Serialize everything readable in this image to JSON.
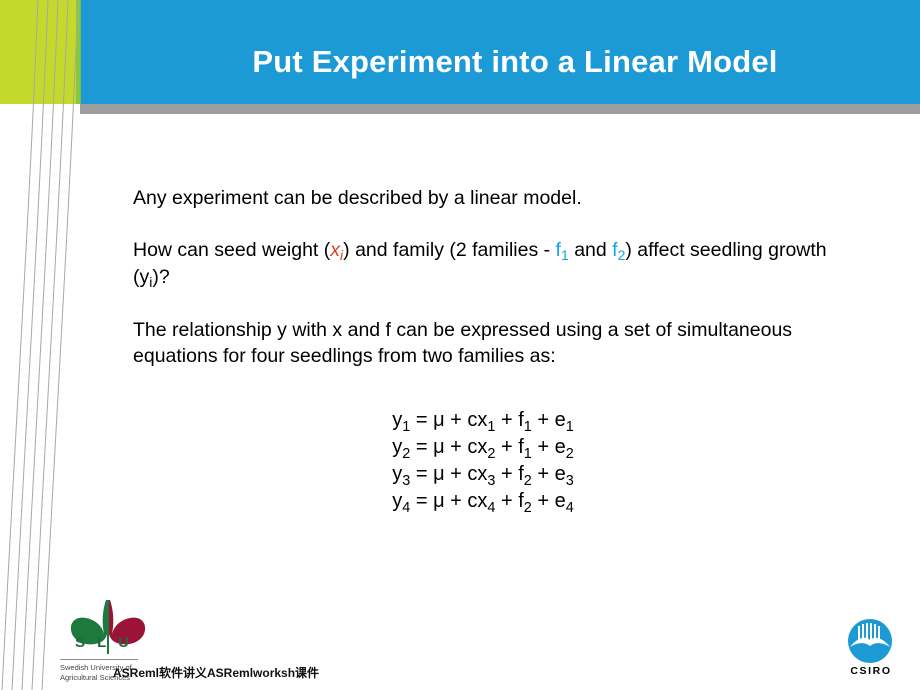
{
  "slide": {
    "title": "Put Experiment into a Linear Model",
    "theme": {
      "header_blue": "#1b9ad6",
      "header_green": "#c3d92b",
      "header_gray": "#9e9e9e",
      "title_color": "#ffffff",
      "accent_red": "#e0401b",
      "accent_blue": "#16a5e0",
      "body_text": "#000000"
    }
  },
  "body": {
    "paragraph1": "Any experiment can be described by a linear model.",
    "paragraph2": {
      "part1": "How can seed weight (",
      "var_x": "x",
      "var_x_sub": "i",
      "part2": ") and family (2 families - ",
      "var_f1": "f",
      "var_f1_sub": "1",
      "part3": " and ",
      "var_f2": "f",
      "var_f2_sub": "2",
      "part4": ") affect seedling growth (y",
      "var_y_sub": "i",
      "part5": ")?"
    },
    "paragraph3": "The relationship y with x and f can be expressed using a set of simultaneous equations for four seedlings from two families as:"
  },
  "equations": {
    "lines": [
      {
        "lhs": "y",
        "lhs_sub": "1",
        "eq": " = μ + cx",
        "x_sub": "1",
        "plus_f": " + f",
        "f_sub": "1",
        "plus_e": " + e",
        "e_sub": "1"
      },
      {
        "lhs": "y",
        "lhs_sub": "2",
        "eq": " = μ + cx",
        "x_sub": "2",
        "plus_f": " + f",
        "f_sub": "1",
        "plus_e": " + e",
        "e_sub": "2"
      },
      {
        "lhs": "y",
        "lhs_sub": "3",
        "eq": " = μ + cx",
        "x_sub": "3",
        "plus_f": " + f",
        "f_sub": "2",
        "plus_e": " + e",
        "e_sub": "3"
      },
      {
        "lhs": "y",
        "lhs_sub": "4",
        "eq": " = μ + cx",
        "x_sub": "4",
        "plus_f": " + f",
        "f_sub": "2",
        "plus_e": " + e",
        "e_sub": "4"
      }
    ]
  },
  "logos": {
    "slu": {
      "wordmark": "S L U",
      "tagline_line1": "Swedish University of",
      "tagline_line2": "Agricultural Sciences",
      "leaf_green": "#1e7a3c",
      "leaf_red": "#9b1438"
    },
    "csiro": {
      "wordmark": "CSIRO",
      "circle_color": "#1b9ad6"
    }
  },
  "footer": {
    "overlay_text": "ASReml软件讲义ASRemlworksh课件"
  }
}
